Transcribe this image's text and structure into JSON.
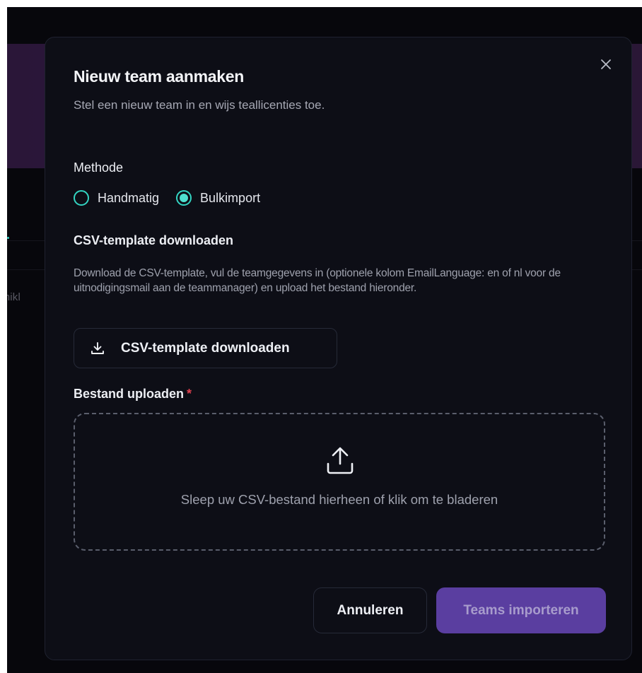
{
  "background": {
    "partial_text": "chikl",
    "accent_color": "#2fd3c6"
  },
  "dialog": {
    "close_icon": "close-icon",
    "title": "Nieuw team aanmaken",
    "subtitle": "Stel een nieuw team in en wijs teallicenties toe.",
    "method": {
      "label": "Methode",
      "options": [
        {
          "label": "Handmatig",
          "checked": false
        },
        {
          "label": "Bulkimport",
          "checked": true
        }
      ]
    },
    "csv_template": {
      "heading": "CSV-template downloaden",
      "description": "Download de CSV-template, vul de teamgegevens in (optionele kolom EmailLanguage: en of nl voor de uitnodigingsmail aan de teammanager) en upload het bestand hieronder.",
      "button_label": "CSV-template downloaden",
      "button_icon": "download-icon"
    },
    "upload": {
      "label": "Bestand uploaden",
      "required_marker": "*",
      "dropzone_icon": "upload-icon",
      "dropzone_text": "Sleep uw CSV-bestand hierheen of klik om te bladeren"
    },
    "footer": {
      "cancel_label": "Annuleren",
      "submit_label": "Teams importeren"
    },
    "colors": {
      "accent": "#4fe0cf",
      "primary_button": "#5a3ea0",
      "required": "#e0414f"
    }
  }
}
